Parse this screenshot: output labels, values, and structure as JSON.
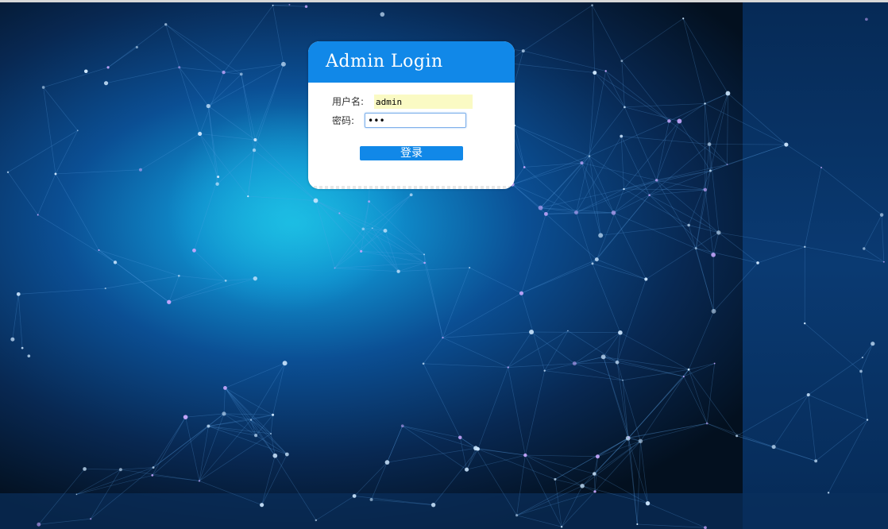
{
  "login": {
    "title": "Admin Login",
    "username_label": "用户名:",
    "username_value": "admin",
    "password_label": "密码:",
    "password_value": "•••",
    "submit_label": "登录"
  },
  "colors": {
    "accent": "#1188e8",
    "autofill": "#fafac4",
    "background_dark": "#041426"
  }
}
